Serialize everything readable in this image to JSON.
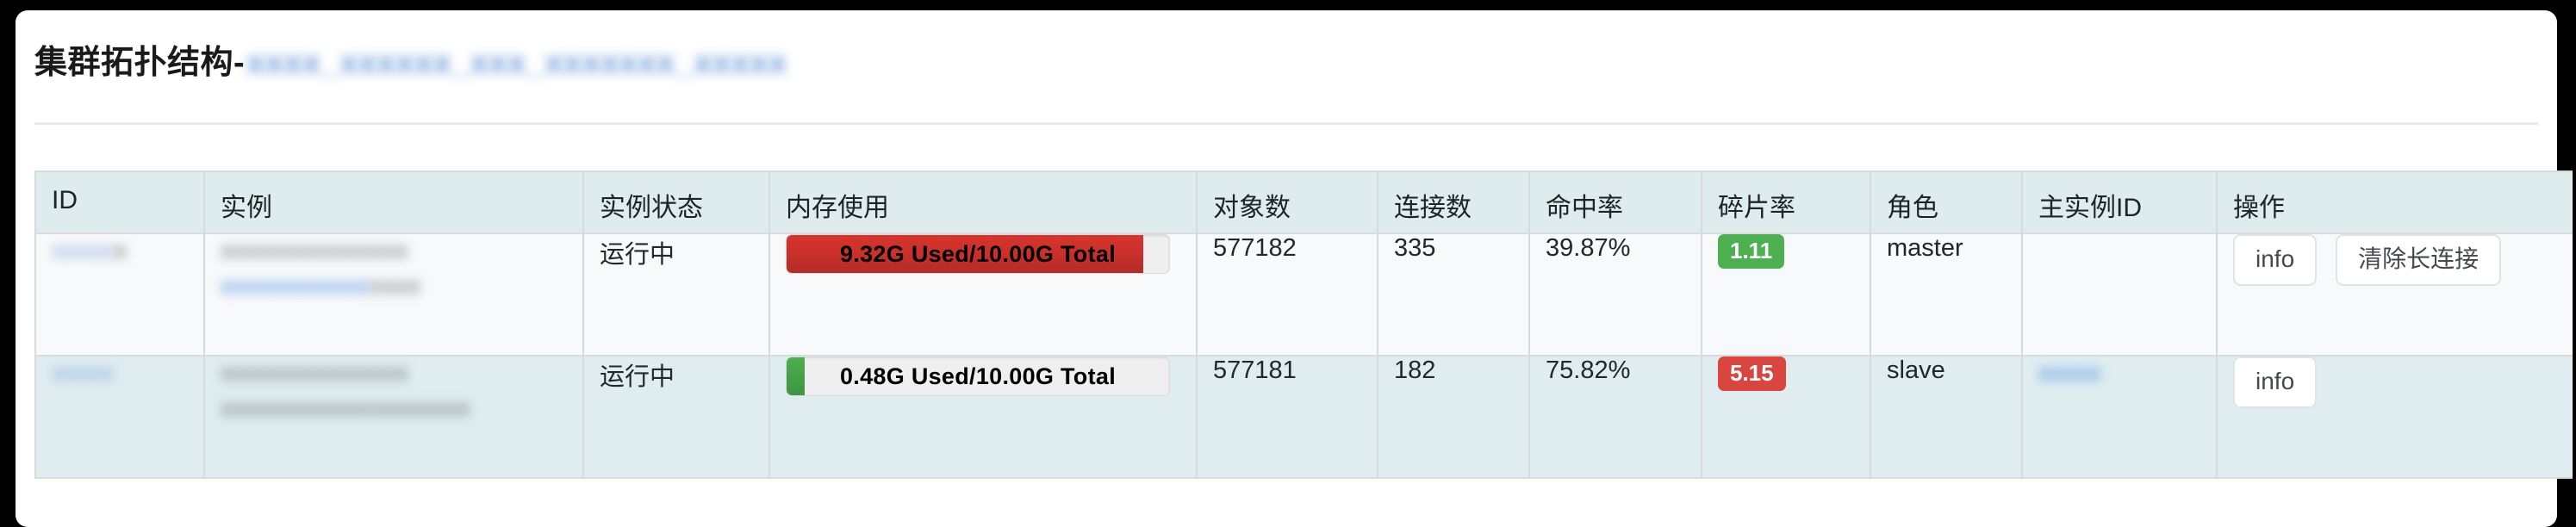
{
  "page": {
    "title_visible": "集群拓扑结构-",
    "title_redacted": "xxxx_xxxxxx_xxx_xxxxxxx_xxxxx"
  },
  "table": {
    "headers": [
      "ID",
      "实例",
      "实例状态",
      "内存使用",
      "对象数",
      "连接数",
      "命中率",
      "碎片率",
      "角色",
      "主实例ID",
      "操作"
    ],
    "rows": [
      {
        "id": "xxxxx",
        "id_suffix": "x",
        "instance_line1": "xxxxxxxxxxxxxxx",
        "instance_line2": "xxxxxxxxxxxx",
        "instance_line2_suffix": "xxxx",
        "state": "运行中",
        "memory_label": "9.32G  Used/10.00G  Total",
        "memory_used_g": 9.32,
        "memory_total_g": 10.0,
        "memory_percent": 93.2,
        "memory_color": "#c9302c",
        "memory_level": "danger",
        "objects": "577182",
        "connections": "335",
        "hit_rate": "39.87%",
        "fragmentation": "1.11",
        "fragmentation_level": "success",
        "fragmentation_color": "#4caf50",
        "role": "master",
        "master_id": "",
        "actions": [
          "info",
          "清除长连接"
        ]
      },
      {
        "id": "xxxxx",
        "id_suffix": "",
        "instance_line1": "xxxxxxxxxxxxxxx",
        "instance_line2": "xxxxxxxxxxxx",
        "instance_line2_suffix": "xxxxxxxx",
        "state": "运行中",
        "memory_label": "0.48G  Used/10.00G  Total",
        "memory_used_g": 0.48,
        "memory_total_g": 10.0,
        "memory_percent": 4.8,
        "memory_color": "#4caf50",
        "memory_level": "success",
        "objects": "577181",
        "connections": "182",
        "hit_rate": "75.82%",
        "fragmentation": "5.15",
        "fragmentation_level": "danger",
        "fragmentation_color": "#d9453f",
        "role": "slave",
        "master_id": "xxxxx",
        "actions": [
          "info"
        ]
      }
    ]
  }
}
